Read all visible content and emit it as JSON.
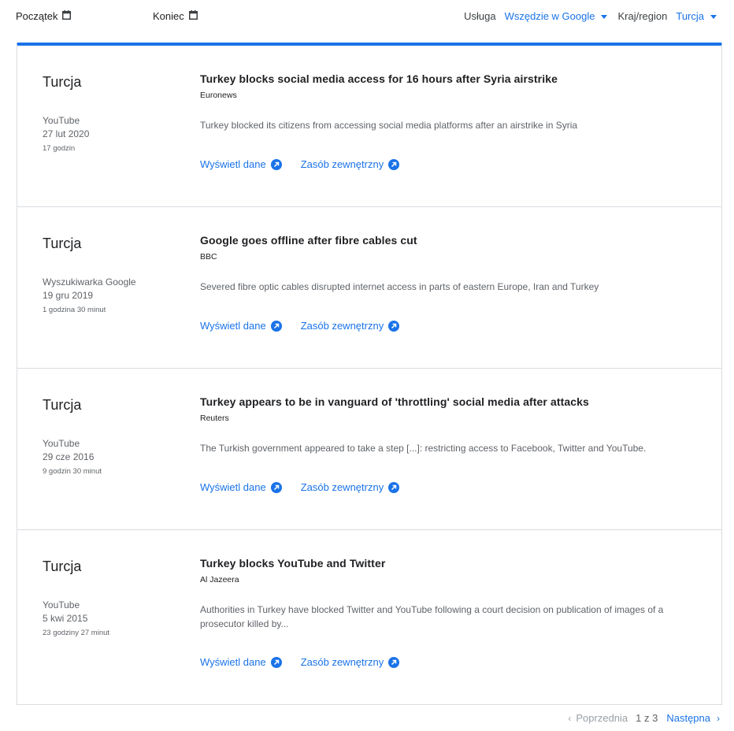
{
  "filters": {
    "start_label": "Początek",
    "end_label": "Koniec",
    "service_label": "Usługa",
    "service_value": "Wszędzie w Google",
    "region_label": "Kraj/region",
    "region_value": "Turcja"
  },
  "link_labels": {
    "view_data": "Wyświetl dane",
    "external": "Zasób zewnętrzny"
  },
  "results": [
    {
      "country": "Turcja",
      "service": "YouTube",
      "date": "27 lut 2020",
      "duration": "17 godzin",
      "title": "Turkey blocks social media access for 16 hours after Syria airstrike",
      "source": "Euronews",
      "description": "Turkey blocked its citizens from accessing social media platforms after an airstrike in Syria"
    },
    {
      "country": "Turcja",
      "service": "Wyszukiwarka Google",
      "date": "19 gru 2019",
      "duration": "1 godzina 30 minut",
      "title": "Google goes offline after fibre cables cut",
      "source": "BBC",
      "description": "Severed fibre optic cables disrupted internet access in parts of eastern Europe, Iran and Turkey"
    },
    {
      "country": "Turcja",
      "service": "YouTube",
      "date": "29 cze 2016",
      "duration": "9 godzin 30 minut",
      "title": "Turkey appears to be in vanguard of 'throttling' social media after attacks",
      "source": "Reuters",
      "description": "The Turkish government appeared to take a step [...]: restricting access to Facebook, Twitter and YouTube."
    },
    {
      "country": "Turcja",
      "service": "YouTube",
      "date": "5 kwi 2015",
      "duration": "23 godziny 27 minut",
      "title": "Turkey blocks YouTube and Twitter",
      "source": "Al Jazeera",
      "description": "Authorities in Turkey have blocked Twitter and YouTube following a court decision on publication of images of a prosecutor killed by..."
    }
  ],
  "pagination": {
    "prev_label": "Poprzednia",
    "page_info": "1 z 3",
    "next_label": "Następna"
  },
  "colors": {
    "accent": "#1a73e8",
    "border": "#dadce0",
    "muted_text": "#5f6368"
  }
}
